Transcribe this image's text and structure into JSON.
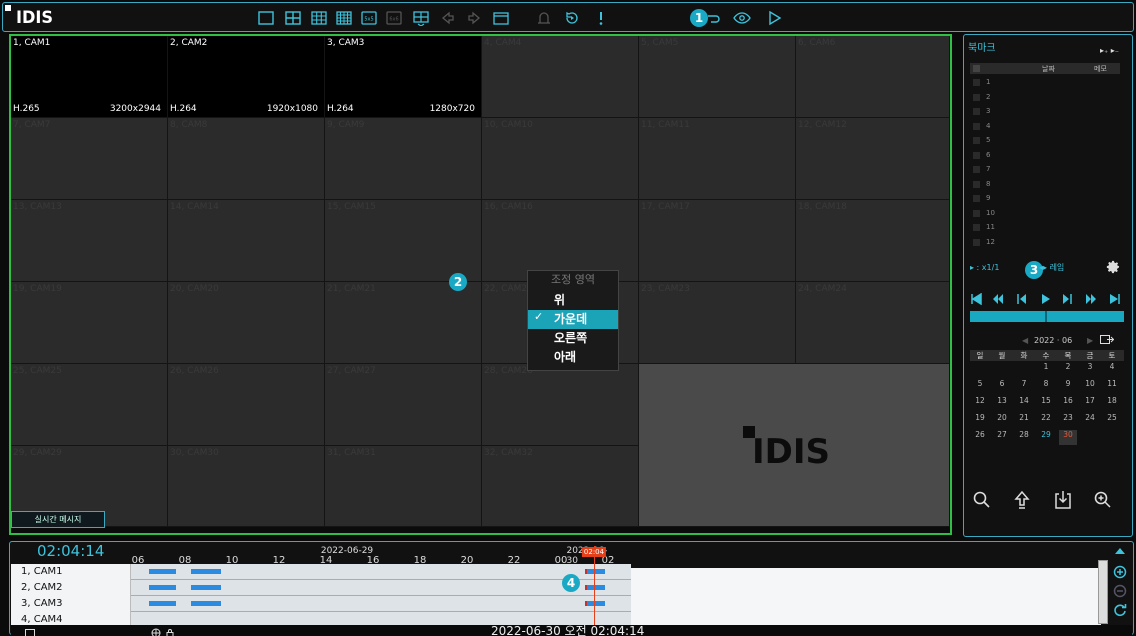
{
  "app": {
    "logo": "IDIS"
  },
  "markers": [
    "1",
    "2",
    "3",
    "4"
  ],
  "toolbar": {
    "icons": [
      "layout-1x1-icon",
      "layout-2x2-icon",
      "layout-3x3-icon",
      "layout-4x4-icon",
      "layout-5x5-icon",
      "layout-6x6-icon",
      "layout-custom-icon",
      "prev-group-icon",
      "next-group-icon",
      "fullscreen-icon",
      "alarm-bell-icon",
      "instant-replay-icon",
      "alert-icon",
      "setup-icon",
      "live-view-icon",
      "playback-icon"
    ]
  },
  "cameras": [
    {
      "name": "1, CAM1",
      "codec": "H.265",
      "resolution": "3200x2944",
      "live": true
    },
    {
      "name": "2, CAM2",
      "codec": "H.264",
      "resolution": "1920x1080",
      "live": true
    },
    {
      "name": "3, CAM3",
      "codec": "H.264",
      "resolution": "1280x720",
      "live": true
    },
    {
      "name": "4, CAM4"
    },
    {
      "name": "5, CAM5"
    },
    {
      "name": "6, CAM6"
    },
    {
      "name": "7, CAM7"
    },
    {
      "name": "8, CAM8"
    },
    {
      "name": "9, CAM9"
    },
    {
      "name": "10, CAM10"
    },
    {
      "name": "11, CAM11"
    },
    {
      "name": "12, CAM12"
    },
    {
      "name": "13, CAM13"
    },
    {
      "name": "14, CAM14"
    },
    {
      "name": "15, CAM15"
    },
    {
      "name": "16, CAM16"
    },
    {
      "name": "17, CAM17"
    },
    {
      "name": "18, CAM18"
    },
    {
      "name": "19, CAM19"
    },
    {
      "name": "20, CAM20"
    },
    {
      "name": "21, CAM21"
    },
    {
      "name": "22, CAM22"
    },
    {
      "name": "23, CAM23"
    },
    {
      "name": "24, CAM24"
    },
    {
      "name": "25, CAM25"
    },
    {
      "name": "26, CAM26"
    },
    {
      "name": "27, CAM27"
    },
    {
      "name": "28, CAM28"
    },
    {
      "name": "29, CAM29"
    },
    {
      "name": "30, CAM30"
    },
    {
      "name": "31, CAM31"
    },
    {
      "name": "32, CAM32"
    }
  ],
  "grid_logo": "IDIS",
  "message_button": "실시간 메시지",
  "context_menu": {
    "title": "조정 영역",
    "items": [
      {
        "label": "위",
        "selected": false
      },
      {
        "label": "가운데",
        "selected": true
      },
      {
        "label": "오른쪽",
        "selected": false
      },
      {
        "label": "아래",
        "selected": false
      }
    ],
    "check": "✓"
  },
  "bookmark": {
    "title": "북마크",
    "tools": "▸₊ ▸₋",
    "headers": [
      "날짜",
      "메모"
    ],
    "rows": [
      "1",
      "2",
      "3",
      "4",
      "5",
      "6",
      "7",
      "8",
      "9",
      "10",
      "11",
      "12"
    ]
  },
  "playback": {
    "speed": "▸ : x1/1",
    "speed_frame": "◂▸ 레임",
    "controls": [
      "skip-start-icon",
      "fast-rewind-icon",
      "step-back-icon",
      "play-icon",
      "step-forward-icon",
      "fast-forward-icon",
      "skip-end-icon"
    ],
    "progress": 0.49
  },
  "calendar": {
    "month": "2022 · 06",
    "weekdays": [
      "일",
      "월",
      "화",
      "수",
      "목",
      "금",
      "토"
    ],
    "weeks": [
      [
        "",
        "",
        "",
        "1",
        "2",
        "3",
        "4"
      ],
      [
        "5",
        "6",
        "7",
        "8",
        "9",
        "10",
        "11"
      ],
      [
        "12",
        "13",
        "14",
        "15",
        "16",
        "17",
        "18"
      ],
      [
        "19",
        "20",
        "21",
        "22",
        "23",
        "24",
        "25"
      ],
      [
        "26",
        "27",
        "28",
        "29",
        "30",
        "",
        ""
      ]
    ],
    "recorded_day": "29",
    "today": "30",
    "colors": {
      "recorded": "#3ec3dc",
      "today": "#e85a3a"
    }
  },
  "side_tools": [
    "search-icon",
    "upload-icon",
    "export-icon",
    "zoom-in-icon"
  ],
  "timeline": {
    "current_time": "02:04:14",
    "hour_labels": [
      "06",
      "08",
      "10",
      "12",
      "14",
      "16",
      "18",
      "20",
      "22",
      "00",
      "02"
    ],
    "date_labels": [
      "2022-06-29",
      "2022-06-30"
    ],
    "cursor_label": "02:04",
    "rows": [
      {
        "name": "1, CAM1"
      },
      {
        "name": "2, CAM2"
      },
      {
        "name": "3, CAM3"
      },
      {
        "name": "4, CAM4"
      }
    ],
    "status": "2022-06-30  오전 02:04:14",
    "colors": {
      "recording": "#2a8be0",
      "event": "#c9302c",
      "cursor": "#e5401a"
    }
  }
}
